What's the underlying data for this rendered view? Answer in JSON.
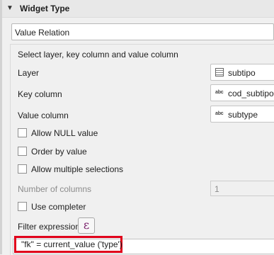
{
  "header": {
    "title": "Widget Type"
  },
  "widget_type_select": {
    "value": "Value Relation"
  },
  "section": {
    "label": "Select layer, key column and value column"
  },
  "layer": {
    "label": "Layer",
    "value": "subtipo"
  },
  "key_column": {
    "label": "Key column",
    "icon_text": "abc",
    "value": "cod_subtipo"
  },
  "value_column": {
    "label": "Value column",
    "icon_text": "abc",
    "value": "subtype"
  },
  "options": {
    "allow_null": "Allow NULL value",
    "order_by_value": "Order by value",
    "allow_multiple": "Allow multiple selections"
  },
  "num_columns": {
    "label": "Number of columns",
    "value": "1"
  },
  "use_completer": {
    "label": "Use completer"
  },
  "filter": {
    "label": "Filter expression",
    "button_glyph": "ε",
    "expression": "\"fk\" = current_value ('type')"
  },
  "colors": {
    "highlight": "#e0001b"
  }
}
